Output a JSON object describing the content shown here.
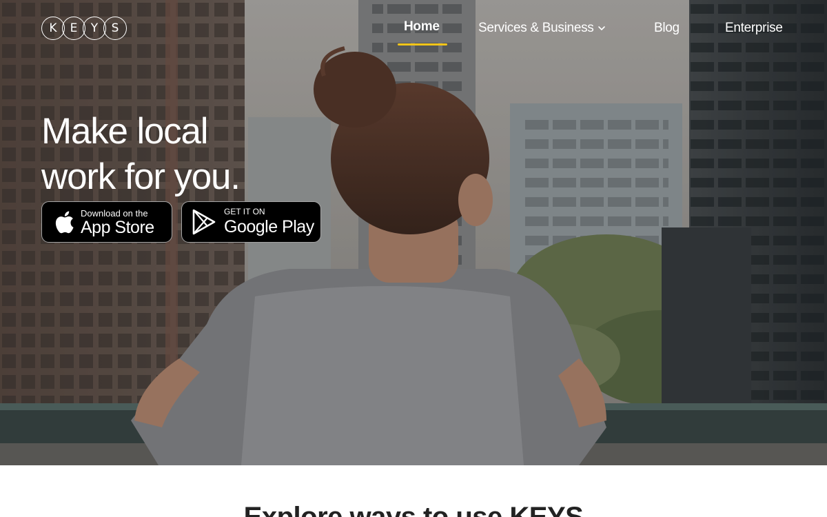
{
  "brand": {
    "logo_letters": [
      "K",
      "E",
      "Y",
      "S"
    ]
  },
  "nav": {
    "home": "Home",
    "services": "Services & Business",
    "blog": "Blog",
    "enterprise": "Enterprise",
    "active": "Home"
  },
  "hero": {
    "headline_line1": "Make local",
    "headline_line2": "work for you.",
    "background": "woman-on-balcony-city-view"
  },
  "app_store": {
    "small": "Download on the",
    "big": "App Store",
    "icon": "apple-icon"
  },
  "google_play": {
    "small": "GET IT ON",
    "big": "Google Play",
    "icon": "play-icon"
  },
  "section": {
    "title": "Explore ways to use KEYS"
  },
  "colors": {
    "accent": "#f5c518",
    "button_bg": "#000000",
    "text_light": "#ffffff"
  }
}
